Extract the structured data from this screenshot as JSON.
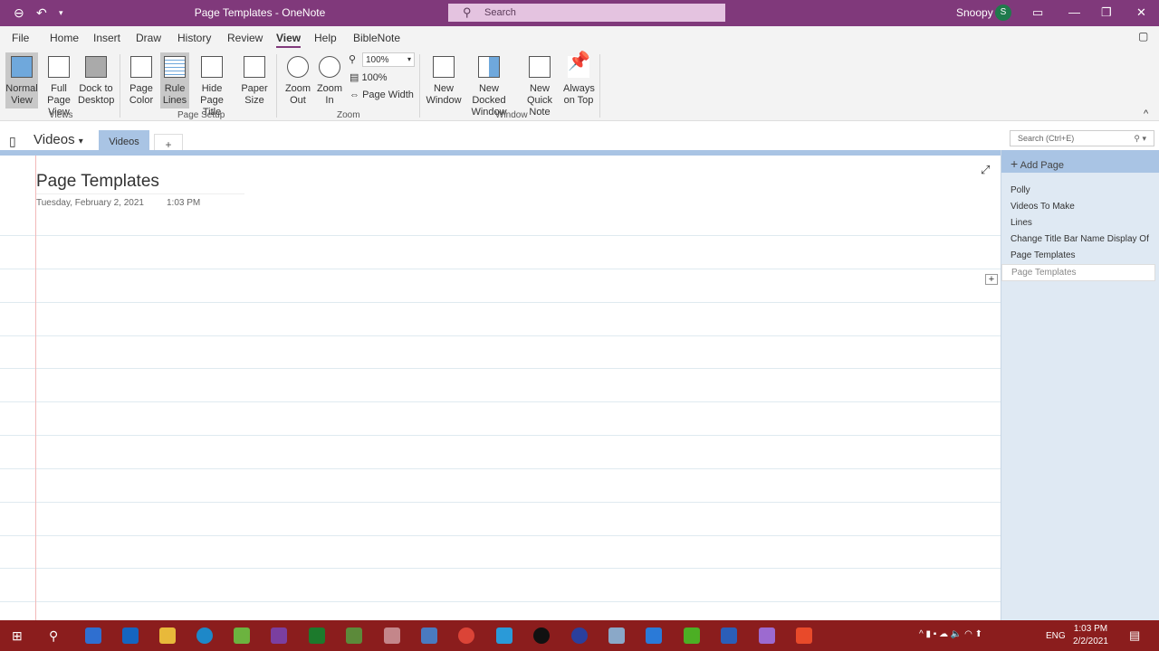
{
  "titlebar": {
    "title": "Page Templates  -  OneNote",
    "search": "Search",
    "user": "Snoopy",
    "avatar": "S"
  },
  "menu": [
    "File",
    "Home",
    "Insert",
    "Draw",
    "History",
    "Review",
    "View",
    "Help",
    "BibleNote"
  ],
  "ribbon": {
    "views": {
      "label": "Views",
      "buttons": [
        "Normal View",
        "Full Page View",
        "Dock to Desktop"
      ]
    },
    "page_setup": {
      "label": "Page Setup",
      "buttons": [
        "Page Color",
        "Rule Lines",
        "Hide Page Title",
        "Paper Size"
      ]
    },
    "zoom": {
      "label": "Zoom",
      "buttons": [
        "Zoom Out",
        "Zoom In"
      ],
      "zoom_value": "100%",
      "percent_100": "100%",
      "page_width": "Page Width"
    },
    "window": {
      "label": "Window",
      "buttons": [
        "New Window",
        "New Docked Window",
        "New Quick Note",
        "Always on Top"
      ]
    }
  },
  "notebook": {
    "name": "Videos",
    "section": "Videos",
    "add_section": "+",
    "search_placeholder": "Search (Ctrl+E)"
  },
  "page": {
    "title": "Page Templates",
    "date": "Tuesday, February 2, 2021",
    "time": "1:03 PM"
  },
  "pages_panel": {
    "add_page": "Add Page",
    "pages": [
      "Polly",
      "Videos To Make",
      "Lines",
      "Change Title Bar Name Display Of",
      "Page Templates",
      "Page Templates"
    ]
  },
  "taskbar": {
    "time": "1:03 PM",
    "date": "2/2/2021",
    "lang": "ENG"
  },
  "colors": {
    "accent": "#80397b",
    "section": "#a9c4e4",
    "taskbar": "#8b1d1d"
  }
}
